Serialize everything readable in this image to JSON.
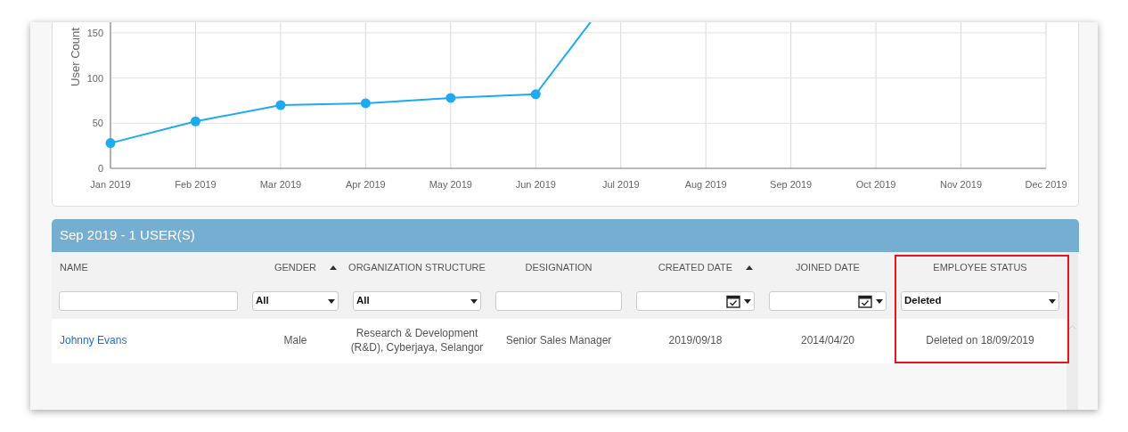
{
  "chart": {
    "chart_data": {
      "type": "line",
      "ylabel": "User Count",
      "categories": [
        "Jan 2019",
        "Feb 2019",
        "Mar 2019",
        "Apr 2019",
        "May 2019",
        "Jun 2019",
        "Jul 2019",
        "Aug 2019",
        "Sep 2019",
        "Oct 2019",
        "Nov 2019",
        "Dec 2019"
      ],
      "series": [
        {
          "color": "#1eaaf1",
          "marker": "circle",
          "values": [
            28,
            52,
            70,
            72,
            78,
            82,
            206,
            null,
            null,
            null,
            null,
            null
          ]
        }
      ],
      "ylim": [
        0,
        210
      ],
      "yticks": [
        0,
        50,
        100,
        150
      ],
      "grid": true
    }
  },
  "panel": {
    "title": "Sep 2019 - 1 USER(S)",
    "columns": [
      {
        "label": "NAME",
        "sorted": false,
        "highlighted": false,
        "filter": {
          "kind": "text"
        }
      },
      {
        "label": "GENDER",
        "sorted": true,
        "highlighted": false,
        "filter": {
          "kind": "select",
          "value": "All"
        }
      },
      {
        "label": "ORGANIZATION STRUCTURE",
        "sorted": false,
        "highlighted": false,
        "filter": {
          "kind": "select",
          "value": "All"
        }
      },
      {
        "label": "DESIGNATION",
        "sorted": false,
        "highlighted": false,
        "filter": {
          "kind": "text"
        }
      },
      {
        "label": "CREATED DATE",
        "sorted": true,
        "highlighted": false,
        "filter": {
          "kind": "date"
        }
      },
      {
        "label": "JOINED DATE",
        "sorted": false,
        "highlighted": false,
        "filter": {
          "kind": "date"
        }
      },
      {
        "label": "EMPLOYEE STATUS",
        "sorted": false,
        "highlighted": true,
        "filter": {
          "kind": "select",
          "value": "Deleted"
        }
      }
    ],
    "rows": [
      {
        "cells": [
          {
            "kind": "link",
            "text": "Johnny Evans"
          },
          {
            "kind": "text",
            "text": "Male"
          },
          {
            "kind": "text",
            "text": "Research & Development (R&D), Cyberjaya, Selangor"
          },
          {
            "kind": "text",
            "text": "Senior Sales Manager"
          },
          {
            "kind": "text",
            "text": "2019/09/18"
          },
          {
            "kind": "text",
            "text": "2014/04/20"
          },
          {
            "kind": "text",
            "text": "Deleted on 18/09/2019"
          }
        ]
      }
    ]
  }
}
